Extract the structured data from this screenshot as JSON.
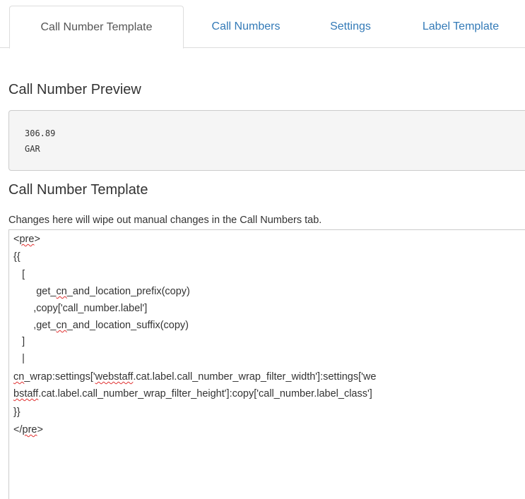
{
  "tabs": [
    {
      "label": "Call Number Template",
      "active": true
    },
    {
      "label": "Call Numbers",
      "active": false
    },
    {
      "label": "Settings",
      "active": false
    },
    {
      "label": "Label Template",
      "active": false
    }
  ],
  "preview": {
    "heading": "Call Number Preview",
    "lines": [
      "306.89",
      "GAR"
    ]
  },
  "template": {
    "heading": "Call Number Template",
    "help_text": "Changes here will wipe out manual changes in the Call Numbers tab.",
    "lines": [
      "<pre>",
      "{{",
      "   [",
      "        get_cn_and_location_prefix(copy)",
      "       ,copy['call_number.label']",
      "       ,get_cn_and_location_suffix(copy)",
      "   ]",
      "   |",
      "cn_wrap:settings['webstaff.cat.label.call_number_wrap_filter_width']:settings['we",
      "bstaff.cat.label.call_number_wrap_filter_height']:copy['call_number.label_class']",
      "}}",
      "</pre>"
    ]
  },
  "colors": {
    "tab_link": "#337ab7",
    "active_tab_text": "#555555",
    "preview_bg": "#f5f5f5",
    "spellcheck_underline": "#e03030"
  }
}
